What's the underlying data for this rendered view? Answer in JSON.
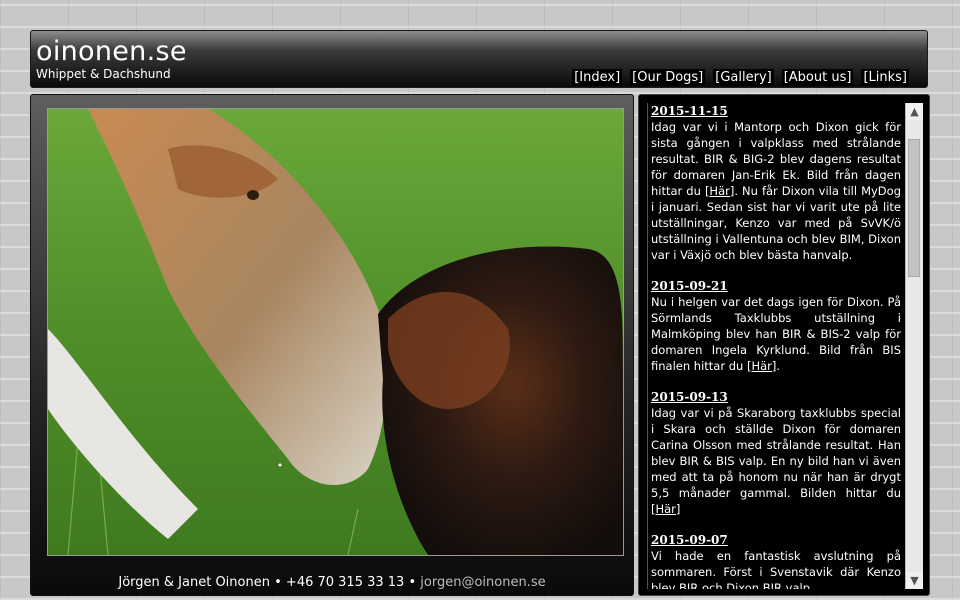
{
  "header": {
    "title": "oinonen.se",
    "subtitle": "Whippet & Dachshund",
    "nav": [
      "[Index]",
      "[Our Dogs]",
      "[Gallery]",
      "[About us]",
      "[Links]"
    ]
  },
  "footer": {
    "names": "Jörgen & Janet Oinonen",
    "separator": "•",
    "phone": "+46 70 315 33 13",
    "email": "jorgen@oinonen.se"
  },
  "news": [
    {
      "date": "2015-11-15",
      "text_before": "Idag var vi i Mantorp och Dixon gick för sista gången i valpklass med strålande resultat. BIR & BIG-2 blev dagens resultat för domaren Jan-Erik Ek. Bild från dagen hittar du ",
      "link": "[Här]",
      "text_after": ". Nu får Dixon vila till MyDog i januari. Sedan sist har vi varit ute på lite utställningar, Kenzo var med på SvVK/ö utställning i Vallentuna och blev BIM, Dixon var i Växjö och blev bästa hanvalp."
    },
    {
      "date": "2015-09-21",
      "text_before": "Nu i helgen var det dags igen för Dixon. På Sörmlands Taxklubbs utställning i Malmköping blev han BIR & BIS-2 valp för domaren Ingela Kyrklund. Bild från BIS finalen hittar du ",
      "link": "[Här]",
      "text_after": "."
    },
    {
      "date": "2015-09-13",
      "text_before": "Idag var vi på Skaraborg taxklubbs special i Skara och ställde Dixon för domaren Carina Olsson med strålande resultat. Han blev BIR & BIS valp. En ny bild han vi även med att ta på honom nu när han är drygt 5,5 månader gammal. Bilden hittar du ",
      "link": "[Här]",
      "text_after": ""
    },
    {
      "date": "2015-09-07",
      "text_before": "Vi hade en fantastisk avslutning på sommaren. Först i Svenstavik där Kenzo blev BIR och Dixon BIR valp",
      "link": "",
      "text_after": ""
    }
  ],
  "icons": {
    "scroll_up": "chevron-up-icon",
    "scroll_down": "chevron-down-icon"
  },
  "colors": {
    "background": "#c8c8c8",
    "panel": "#000000",
    "text": "#ffffff",
    "email": "#bdbdbd"
  }
}
